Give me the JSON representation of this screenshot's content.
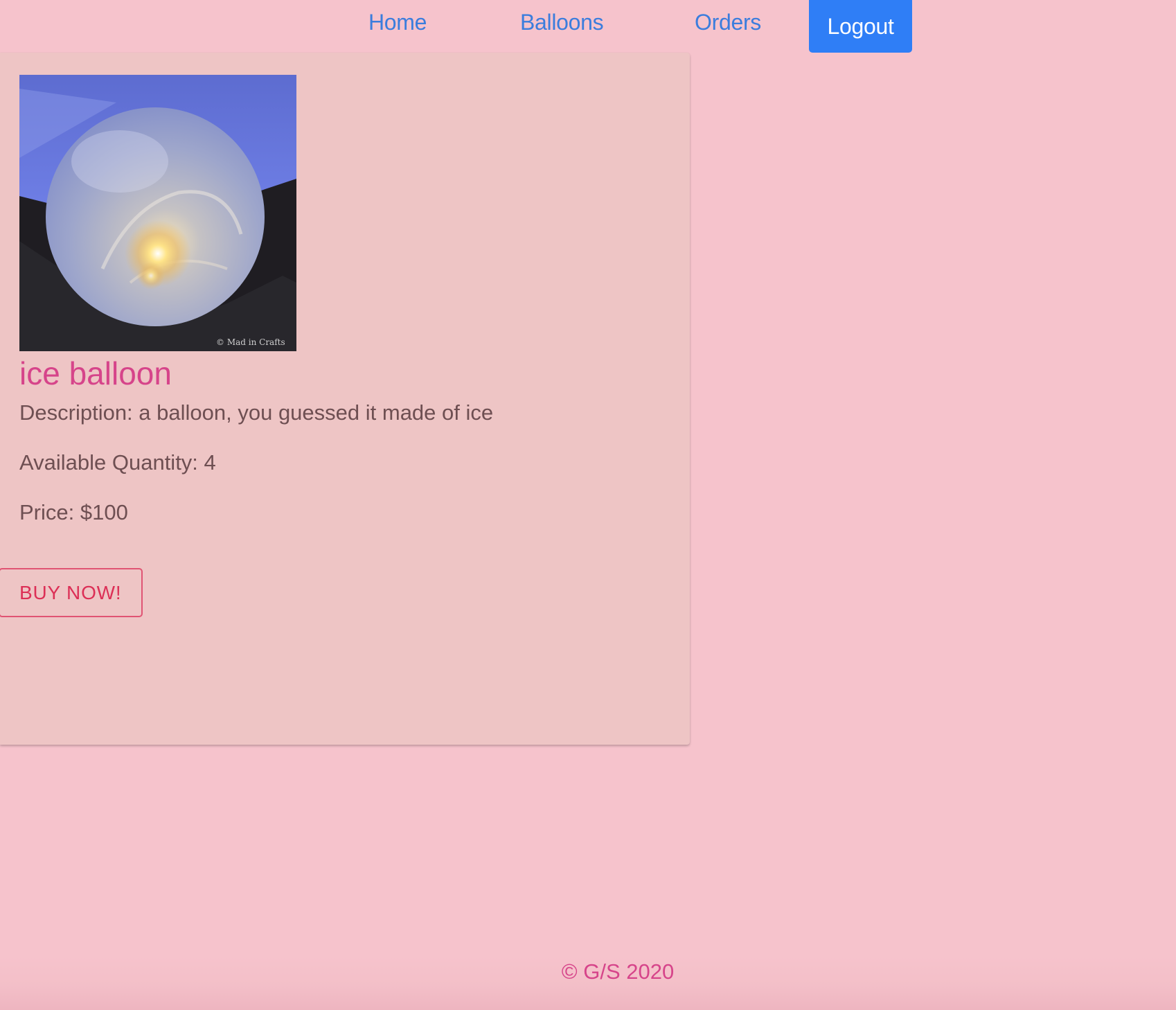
{
  "nav": {
    "home_label": "Home",
    "balloons_label": "Balloons",
    "orders_label": "Orders",
    "logout_label": "Logout"
  },
  "product": {
    "image_caption": "© Mad in Crafts",
    "name": "ice balloon",
    "description": "Description: a balloon, you guessed it made of ice",
    "quantity": "Available Quantity: 4",
    "price": "Price: $100",
    "buy_label": "BUY NOW!"
  },
  "footer": {
    "copyright": "© G/S 2020"
  },
  "colors": {
    "page_background": "#f6c3cc",
    "card_background": "#eec5c5",
    "nav_link": "#3b7ddd",
    "logout_button": "#2f7ef6",
    "accent_pink": "#d6448a",
    "buy_button": "#dc2f56"
  }
}
